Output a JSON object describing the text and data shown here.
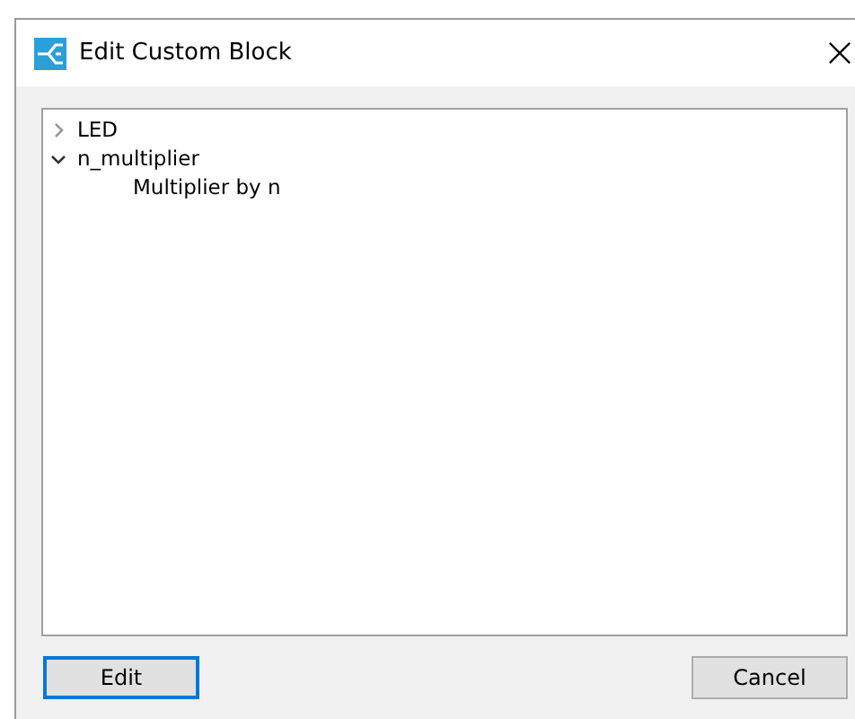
{
  "window": {
    "title": "Edit Custom Block"
  },
  "tree": [
    {
      "label": "LED",
      "expanded": false
    },
    {
      "label": "n_multiplier",
      "expanded": true,
      "children": [
        {
          "label": "Multiplier by n"
        }
      ]
    }
  ],
  "buttons": [
    {
      "label": "Edit",
      "focused": true
    },
    {
      "label": "Cancel",
      "focused": false
    }
  ]
}
